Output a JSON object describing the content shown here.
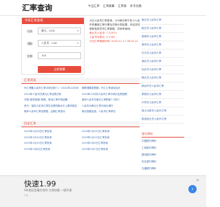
{
  "header": {
    "logo": "汇率查询",
    "nav": [
      "今日汇率",
      "汇率换算",
      "汇率表",
      "外币兑换"
    ]
  },
  "converter": {
    "title": "今日汇率查询",
    "from_label": "兑换:",
    "from_value": "美元 - USD",
    "to_label": "兑换:",
    "to_value": "人民币 - CNY",
    "amount_label": "金额:",
    "amount_value": "100",
    "swap_icon": "swap-icon",
    "submit_label": "立即换算"
  },
  "info": {
    "desc": "今日人民币汇率查询，100美元等于多少人民币的最新汇率行情及兑换计算结果，本站实时更新各类货币汇率数据，供参考使用。",
    "line1": "美元兑人民币: 7.23974",
    "line2": "人民币兑美元: 0.1382",
    "line3": "今日汇率更新时间: 2025-01-17 08:52:21"
  },
  "right_list": [
    "美元兑人民币汇率",
    "欧元兑人民币汇率",
    "英镑兑人民币汇率",
    "港币兑人民币汇率",
    "日元兑人民币汇率",
    "澳元兑人民币汇率",
    "加元兑人民币汇率",
    "韩元兑人民币汇率",
    "新台币兑人民币汇率",
    "泰铢兑人民币汇率",
    "卢布兑人民币汇率",
    "瑞士法郎兑人民币汇率",
    "新加坡元兑人民币汇率"
  ],
  "news": {
    "title": "汇率资讯",
    "items": [
      "外汇储备人民币汇率中间价报7.1（2024年12月06日）",
      "美联储降息预期，外汇汇率波动加大",
      "2024年人民币兑美元汇率走势分析",
      "2024年12月份人民币汇率中间价走势回顾",
      "中国“新型城镇”政策，带动汇率市场回暖",
      "离岸人民币兑美元汇率跌破7.3关口",
      "央行：保持人民币汇率在合理均衡水平上基本稳定",
      "人民币对美元汇率中间价调升",
      "离岸人民币汇率走势图，近期汇率波动",
      "美元指数走强，人民币汇率承压"
    ]
  },
  "history": {
    "title": "历史汇率",
    "items": [
      "2025年1月16日汇率查询",
      "2025年1月15日汇率查询",
      "2025年1月14日汇率查询",
      "2025年1月13日汇率查询",
      "2025年1月10日汇率查询",
      "2025年1月9日汇率查询",
      "2025年1月8日汇率查询",
      "2025年1月7日汇率查询"
    ]
  },
  "right_sec": {
    "title": "银行牌价",
    "items": [
      "中国银行牌价",
      "工商银行牌价",
      "建设银行牌价",
      "农业银行牌价",
      "交通银行牌价"
    ]
  },
  "ad": {
    "title": "快速1.99",
    "subtitle": "0年期还是最好用的 方便快捷 一键开通",
    "label": "广告",
    "close": "✕",
    "arrow": "›"
  }
}
